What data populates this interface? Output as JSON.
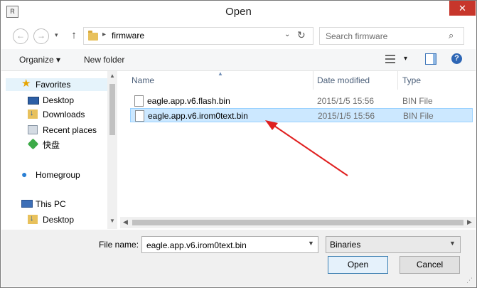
{
  "window": {
    "title": "Open",
    "app_icon": "app-icon",
    "close_label": "✕"
  },
  "address_bar": {
    "back_icon": "←",
    "forward_icon": "→",
    "recent_icon": "▾",
    "up_icon": "↑",
    "separator": "▸",
    "path": "firmware",
    "dropdown_icon": "⌄",
    "refresh_icon": "↻"
  },
  "search": {
    "placeholder": "Search firmware",
    "icon": "⌕"
  },
  "toolbar": {
    "organize_label": "Organize ▾",
    "new_folder_label": "New folder",
    "view_dropdown": "▾",
    "help_label": "?"
  },
  "nav_pane": {
    "items": [
      {
        "label": "Favorites",
        "icon": "star-icon"
      },
      {
        "label": "Desktop",
        "icon": "desktop-icon"
      },
      {
        "label": "Downloads",
        "icon": "downloads-icon"
      },
      {
        "label": "Recent places",
        "icon": "recent-places-icon"
      },
      {
        "label": "快盘",
        "icon": "kuaipan-icon"
      },
      {
        "label": "Homegroup",
        "icon": "homegroup-icon"
      },
      {
        "label": "This PC",
        "icon": "pc-icon"
      },
      {
        "label": "Desktop",
        "icon": "desktop-icon"
      }
    ]
  },
  "file_list": {
    "columns": {
      "name": "Name",
      "date": "Date modified",
      "type": "Type"
    },
    "rows": [
      {
        "name": "eagle.app.v6.flash.bin",
        "date": "2015/1/5 15:56",
        "type": "BIN File",
        "selected": false
      },
      {
        "name": "eagle.app.v6.irom0text.bin",
        "date": "2015/1/5 15:56",
        "type": "BIN File",
        "selected": true
      }
    ]
  },
  "bottom": {
    "file_name_label": "File name:",
    "file_name_value": "eagle.app.v6.irom0text.bin",
    "file_type_value": "Binaries",
    "open_label": "Open",
    "cancel_label": "Cancel"
  },
  "colors": {
    "selection": "#cce8ff",
    "selection_border": "#99d1ff",
    "close_button": "#c7362b",
    "annotation_arrow": "#e02020"
  }
}
